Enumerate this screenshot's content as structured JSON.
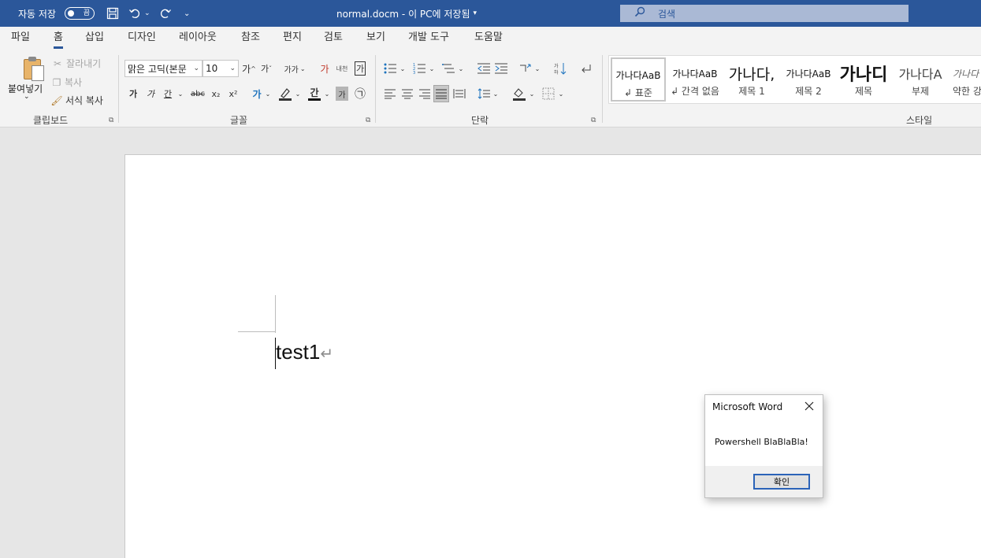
{
  "titlebar": {
    "autosave_label": "자동 저장",
    "autosave_toggle": "끔",
    "doc_title": "normal.docm  -  이 PC에 저장됨",
    "search_placeholder": "검색"
  },
  "tabs": [
    "파일",
    "홈",
    "삽입",
    "디자인",
    "레이아웃",
    "참조",
    "편지",
    "검토",
    "보기",
    "개발 도구",
    "도움말"
  ],
  "ribbon": {
    "clipboard": {
      "paste": "붙여넣기",
      "cut": "잘라내기",
      "copy": "복사",
      "format_painter": "서식 복사",
      "label": "클립보드"
    },
    "font": {
      "font_name": "맑은 고딕(본문",
      "font_size": "10",
      "grow": "가",
      "shrink": "가",
      "case": "가가",
      "clear": "가",
      "phonetic": "내천",
      "border_char": "가",
      "bold": "가",
      "italic": "가",
      "underline": "간",
      "strike": "abc",
      "subscript": "x₂",
      "superscript": "x²",
      "effects": "가",
      "char_shade": "가",
      "enclose": "㉠",
      "label": "글꼴"
    },
    "paragraph": {
      "label": "단락"
    },
    "styles": {
      "label": "스타일",
      "items": [
        {
          "preview": "가나다AaB",
          "name": "↲ 표준"
        },
        {
          "preview": "가나다AaB",
          "name": "↲ 간격 없음"
        },
        {
          "preview": "가나다,",
          "name": "제목 1"
        },
        {
          "preview": "가나다AaB",
          "name": "제목 2"
        },
        {
          "preview": "가나디",
          "name": "제목"
        },
        {
          "preview": "가나다A",
          "name": "부제"
        },
        {
          "preview": "가나다",
          "name": "약한 강"
        }
      ]
    }
  },
  "document": {
    "text": "test1",
    "para_mark": "↵"
  },
  "dialog": {
    "title": "Microsoft Word",
    "message": "Powershell BlaBlaBla!",
    "ok_label": "확인"
  },
  "colors": {
    "brand_blue": "#2b579a",
    "ribbon_bg": "#f3f3f3",
    "canvas_bg": "#e6e6e6"
  }
}
